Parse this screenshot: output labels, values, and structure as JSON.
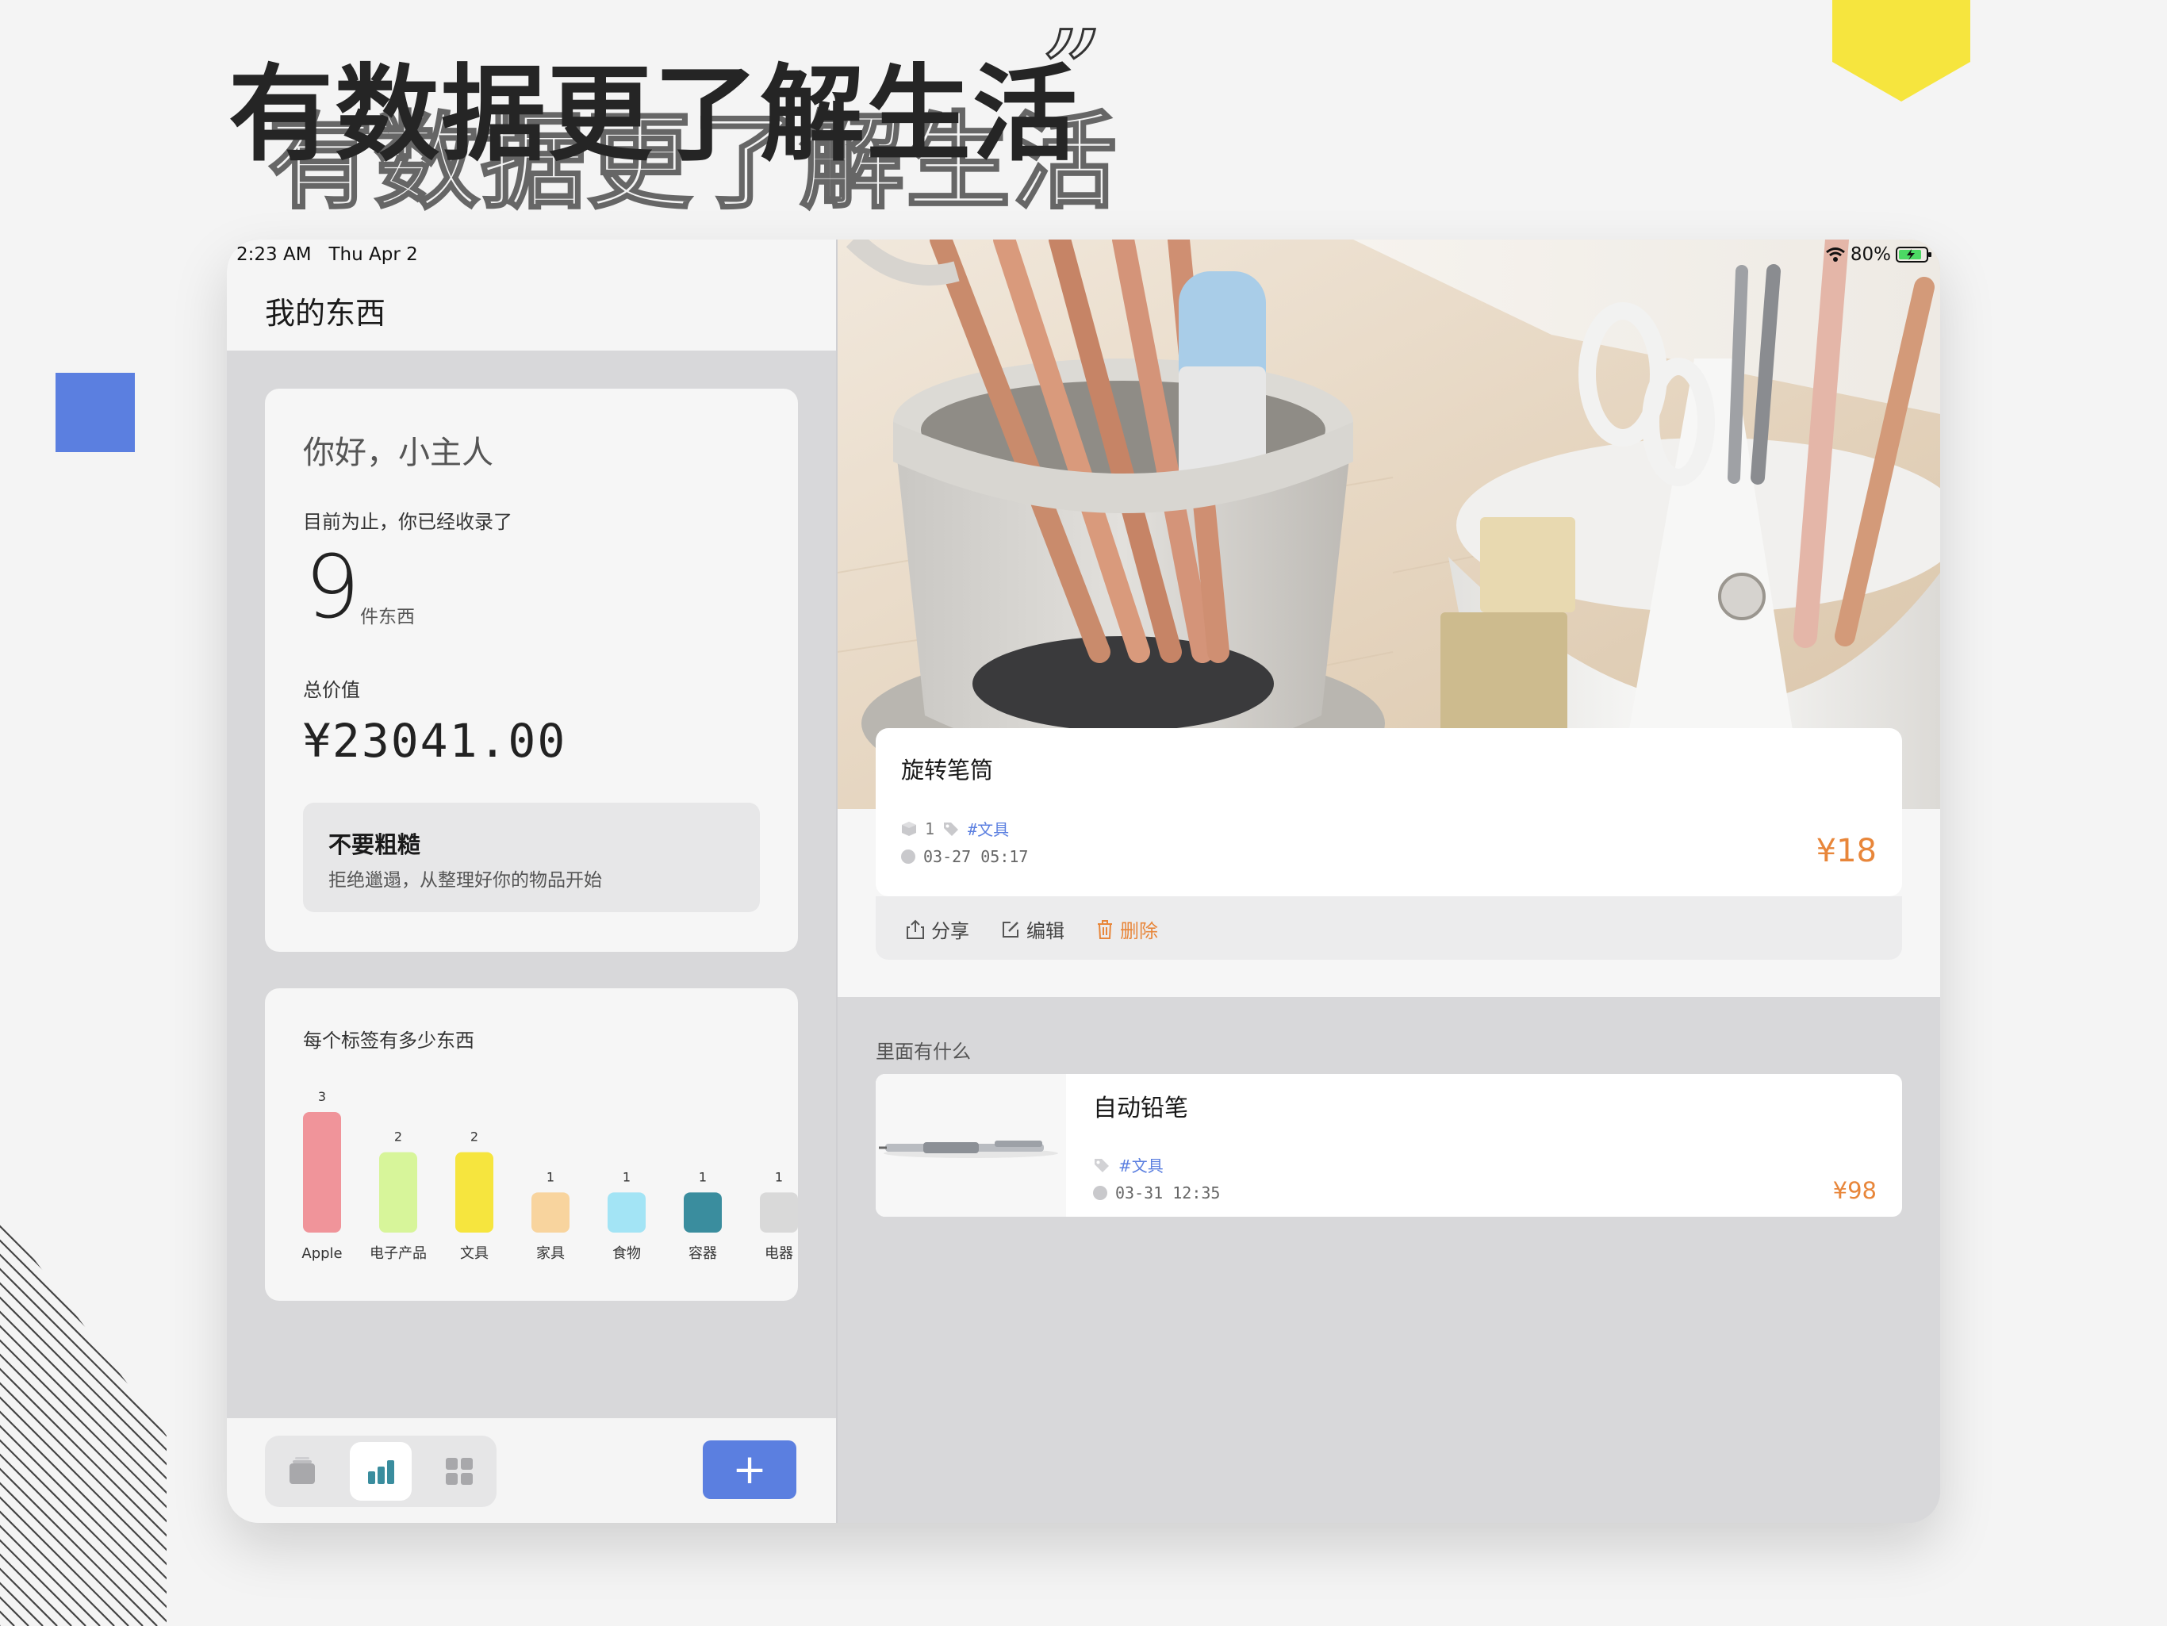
{
  "headline": {
    "text": "有数据更了解生活",
    "quote_mark": "”"
  },
  "status_bar": {
    "time": "2:23 AM",
    "date": "Thu Apr 2",
    "battery": "80%"
  },
  "app": {
    "title": "我的东西"
  },
  "summary": {
    "greeting": "你好，小主人",
    "collected_label": "目前为止，你已经收录了",
    "count": "9",
    "count_unit": "件东西",
    "total_label": "总价值",
    "total_value": "¥23041.00",
    "motto_title": "不要粗糙",
    "motto_subtitle": "拒绝邋遢，从整理好你的物品开始"
  },
  "chart_data": {
    "type": "bar",
    "title": "每个标签有多少东西",
    "categories": [
      "Apple",
      "电子产品",
      "文具",
      "家具",
      "食物",
      "容器",
      "电器"
    ],
    "values": [
      3,
      2,
      2,
      1,
      1,
      1,
      1
    ],
    "colors": [
      "#f0949a",
      "#d7f59a",
      "#f6e53e",
      "#f8d49e",
      "#a3e4f5",
      "#3a8d9e",
      "#d9d9d9"
    ],
    "ylim": [
      0,
      3
    ]
  },
  "tabbar": {
    "tabs": [
      {
        "icon": "box-icon"
      },
      {
        "icon": "chart-icon"
      },
      {
        "icon": "grid-icon"
      }
    ],
    "add_label": "+"
  },
  "detail": {
    "name": "旋转笔筒",
    "quantity": "1",
    "tag": "#文具",
    "date": "03-27 05:17",
    "price": "¥18",
    "actions": {
      "share": "分享",
      "edit": "编辑",
      "delete": "删除"
    }
  },
  "contents": {
    "label": "里面有什么",
    "items": [
      {
        "name": "自动铅笔",
        "tag": "#文具",
        "date": "03-31 12:35",
        "price": "¥98"
      }
    ]
  },
  "colors": {
    "accent": "#5b7fe0",
    "price": "#e8863a",
    "yellow": "#f6e53e"
  }
}
